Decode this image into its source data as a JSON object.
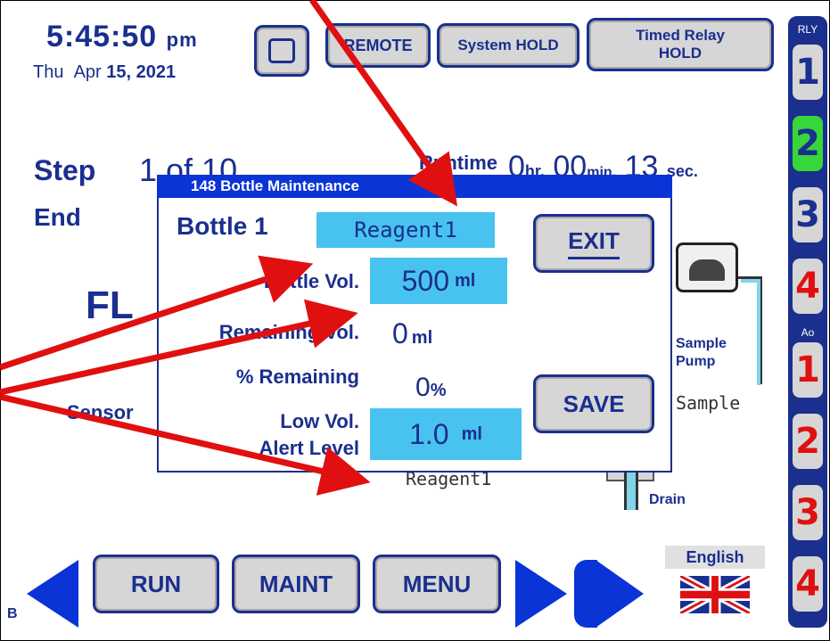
{
  "header": {
    "time": "5:45:50",
    "ampm": "pm",
    "day": "Thu",
    "month": "Apr",
    "date": "15, 2021",
    "remote_label": "REMOTE",
    "system_hold_label": "System HOLD",
    "timed_relay_line1": "Timed Relay",
    "timed_relay_line2": "HOLD"
  },
  "status": {
    "step_label": "Step",
    "step_value": "1 of 10",
    "runtime_label": "Runtime",
    "hr_value": "0",
    "hr_unit": "hr.",
    "min_value": "00",
    "min_unit": "min.",
    "sec_value": "13",
    "sec_unit": "sec.",
    "end_label": "End",
    "process_text": "FL",
    "sensor_label": "Sensor",
    "reagent_bg_label": "Reagent1",
    "sample_pump_line1": "Sample",
    "sample_pump_line2": "Pump",
    "sample_label": "Sample",
    "drain_label": "Drain"
  },
  "dialog": {
    "title": "148  Bottle Maintenance",
    "bottle_label": "Bottle 1",
    "reagent_name": "Reagent1",
    "bottle_vol_label": "Bottle Vol.",
    "bottle_vol_value": "500",
    "bottle_vol_unit": "ml",
    "remaining_vol_label": "Remaining Vol.",
    "remaining_vol_value": "0",
    "remaining_vol_unit": "ml",
    "pct_remaining_label": "% Remaining",
    "pct_remaining_value": "0",
    "pct_unit": "%",
    "low_vol_label_line1": "Low Vol.",
    "low_vol_label_line2": "Alert Level",
    "low_vol_value": "1.0",
    "low_vol_unit": "ml",
    "exit_label": "EXIT",
    "save_label": "SAVE"
  },
  "sidebar": {
    "rly_label": "RLY",
    "ao_label": "Ao",
    "relays": [
      {
        "label": "1",
        "color": "#1a2f8e",
        "bg": "#d6d6d6"
      },
      {
        "label": "2",
        "color": "#1a2f8e",
        "bg": "#37d63a"
      },
      {
        "label": "3",
        "color": "#1a2f8e",
        "bg": "#d6d6d6"
      },
      {
        "label": "4",
        "color": "#e01010",
        "bg": "#d6d6d6"
      }
    ],
    "aos": [
      {
        "label": "1",
        "color": "#e01010"
      },
      {
        "label": "2",
        "color": "#e01010"
      },
      {
        "label": "3",
        "color": "#e01010"
      },
      {
        "label": "4",
        "color": "#e01010"
      }
    ]
  },
  "footer": {
    "run_label": "RUN",
    "maint_label": "MAINT",
    "menu_label": "MENU",
    "language_label": "English",
    "corner_label": "B"
  },
  "colors": {
    "navy": "#1a2f8e",
    "blue": "#0b34d6",
    "field": "#48c3ef",
    "annotation": "#e01010"
  }
}
